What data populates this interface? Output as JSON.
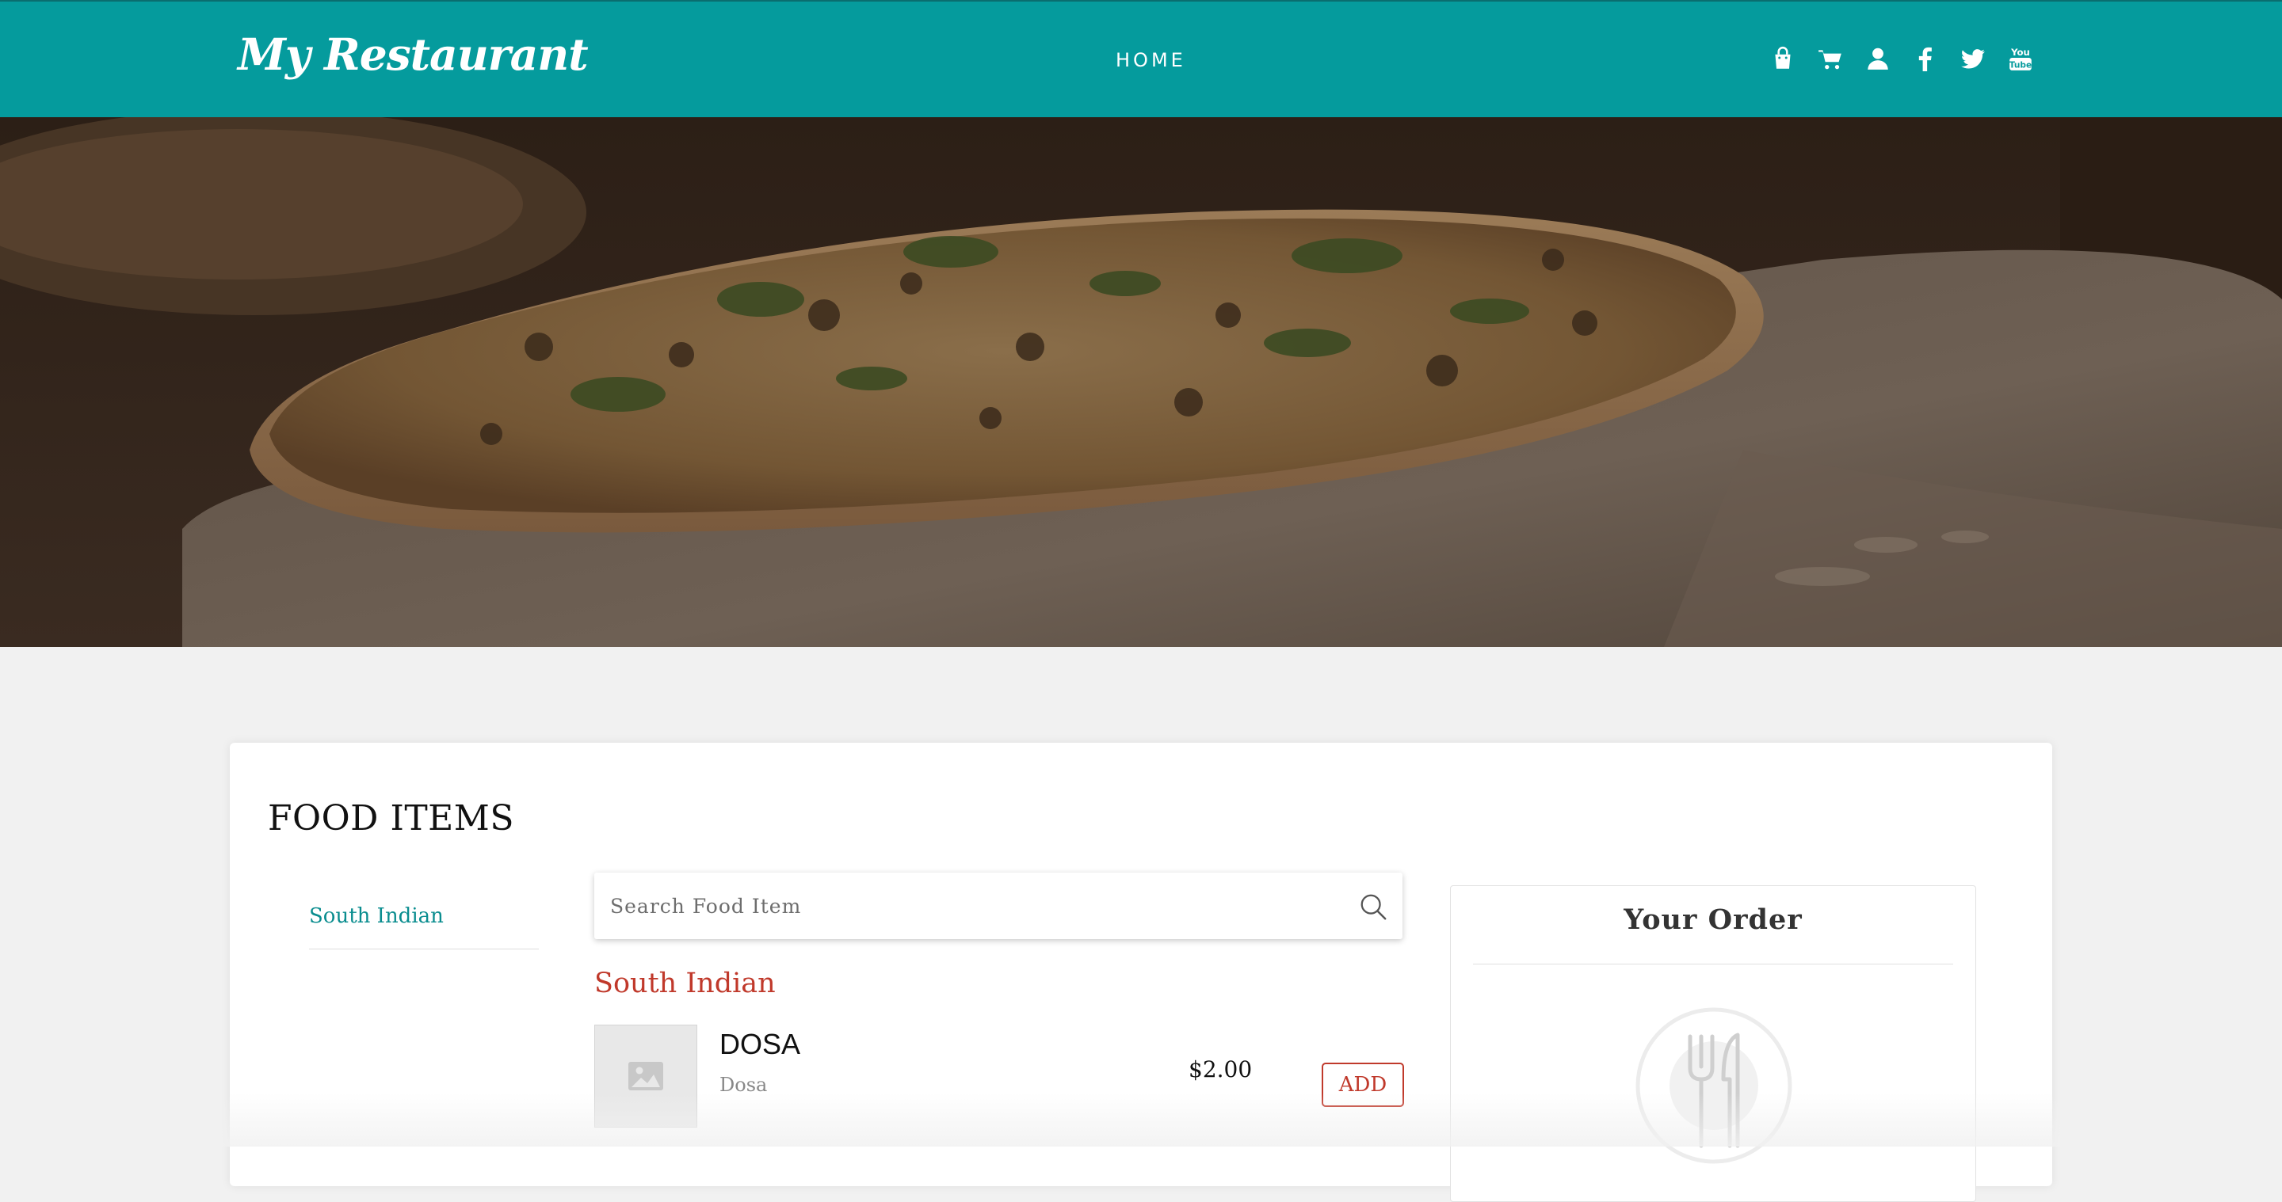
{
  "header": {
    "brand": "My Restaurant",
    "nav": {
      "home": "HOME"
    },
    "icons": [
      "shopping-bag-icon",
      "cart-icon",
      "user-icon",
      "facebook-icon",
      "twitter-icon",
      "youtube-icon"
    ],
    "youtube_label_top": "You",
    "youtube_label_bottom": "Tube",
    "background_color": "#059b9d"
  },
  "main": {
    "title": "FOOD ITEMS",
    "categories": [
      {
        "label": "South Indian"
      }
    ],
    "search": {
      "placeholder": "Search Food Item",
      "value": ""
    },
    "sections": [
      {
        "heading": "South Indian",
        "items": [
          {
            "name": "DOSA",
            "description": "Dosa",
            "price": "$2.00",
            "button": "ADD"
          }
        ]
      }
    ]
  },
  "order": {
    "title": "Your Order",
    "empty_icon": "fork-knife-icon"
  },
  "colors": {
    "accent": "#0a8d8f",
    "section_heading": "#c0392b",
    "add_button": "#c0392b"
  }
}
